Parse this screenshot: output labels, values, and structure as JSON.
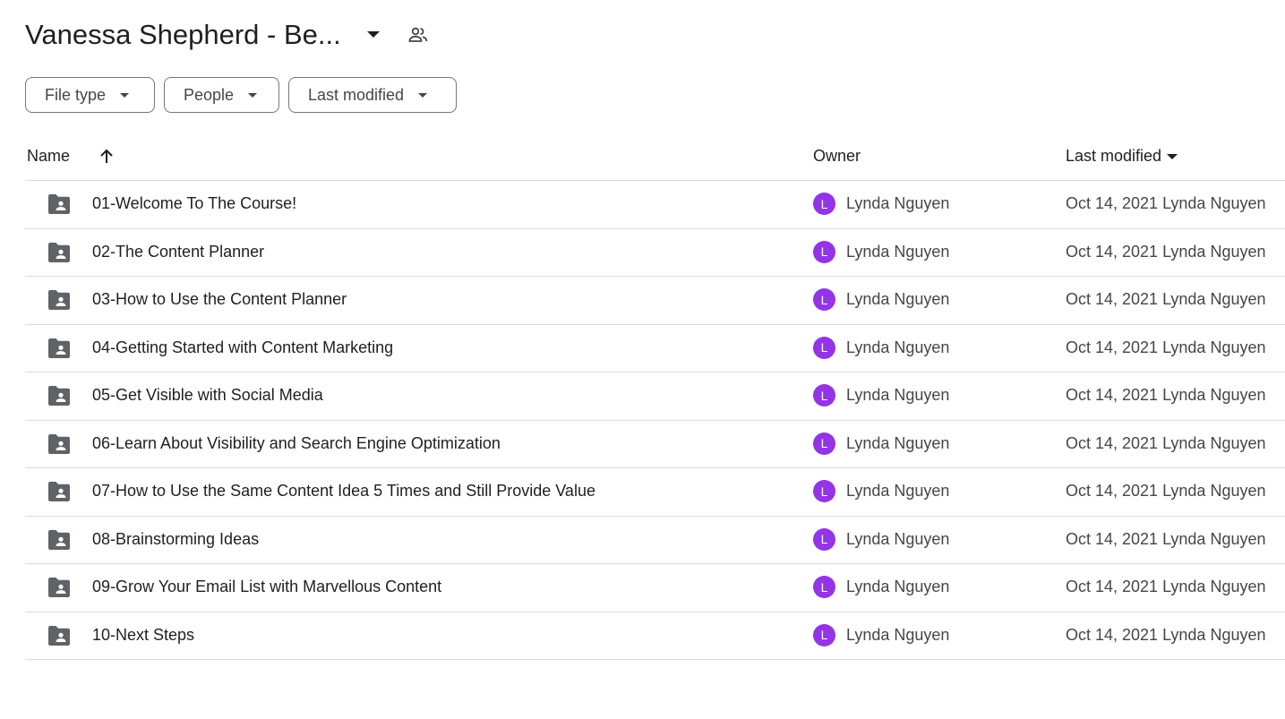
{
  "header": {
    "title": "Vanessa Shepherd - Be...",
    "title_caret_icon": "arrow-drop-down-icon",
    "share_icon": "people-icon"
  },
  "filters": [
    {
      "label": "File type"
    },
    {
      "label": "People"
    },
    {
      "label": "Last modified"
    }
  ],
  "table": {
    "columns": {
      "name": "Name",
      "owner": "Owner",
      "last_modified": "Last modified"
    },
    "sort_icon": "arrow-upward-icon",
    "rows": [
      {
        "name": "01-Welcome To The Course!",
        "owner": "Lynda Nguyen",
        "owner_initial": "L",
        "modified": "Oct 14, 2021 Lynda Nguyen"
      },
      {
        "name": "02-The Content Planner",
        "owner": "Lynda Nguyen",
        "owner_initial": "L",
        "modified": "Oct 14, 2021 Lynda Nguyen"
      },
      {
        "name": "03-How to Use the Content Planner",
        "owner": "Lynda Nguyen",
        "owner_initial": "L",
        "modified": "Oct 14, 2021 Lynda Nguyen"
      },
      {
        "name": "04-Getting Started with Content Marketing",
        "owner": "Lynda Nguyen",
        "owner_initial": "L",
        "modified": "Oct 14, 2021 Lynda Nguyen"
      },
      {
        "name": "05-Get Visible with Social Media",
        "owner": "Lynda Nguyen",
        "owner_initial": "L",
        "modified": "Oct 14, 2021 Lynda Nguyen"
      },
      {
        "name": "06-Learn About Visibility and Search Engine Optimization",
        "owner": "Lynda Nguyen",
        "owner_initial": "L",
        "modified": "Oct 14, 2021 Lynda Nguyen"
      },
      {
        "name": "07-How to Use the Same Content Idea 5 Times and Still Provide Value",
        "owner": "Lynda Nguyen",
        "owner_initial": "L",
        "modified": "Oct 14, 2021 Lynda Nguyen"
      },
      {
        "name": "08-Brainstorming Ideas",
        "owner": "Lynda Nguyen",
        "owner_initial": "L",
        "modified": "Oct 14, 2021 Lynda Nguyen"
      },
      {
        "name": "09-Grow Your Email List with Marvellous Content",
        "owner": "Lynda Nguyen",
        "owner_initial": "L",
        "modified": "Oct 14, 2021 Lynda Nguyen"
      },
      {
        "name": "10-Next Steps",
        "owner": "Lynda Nguyen",
        "owner_initial": "L",
        "modified": "Oct 14, 2021 Lynda Nguyen"
      }
    ]
  },
  "colors": {
    "avatar": "#9334e6",
    "folder": "#5f6368",
    "divider": "#dadce0"
  }
}
